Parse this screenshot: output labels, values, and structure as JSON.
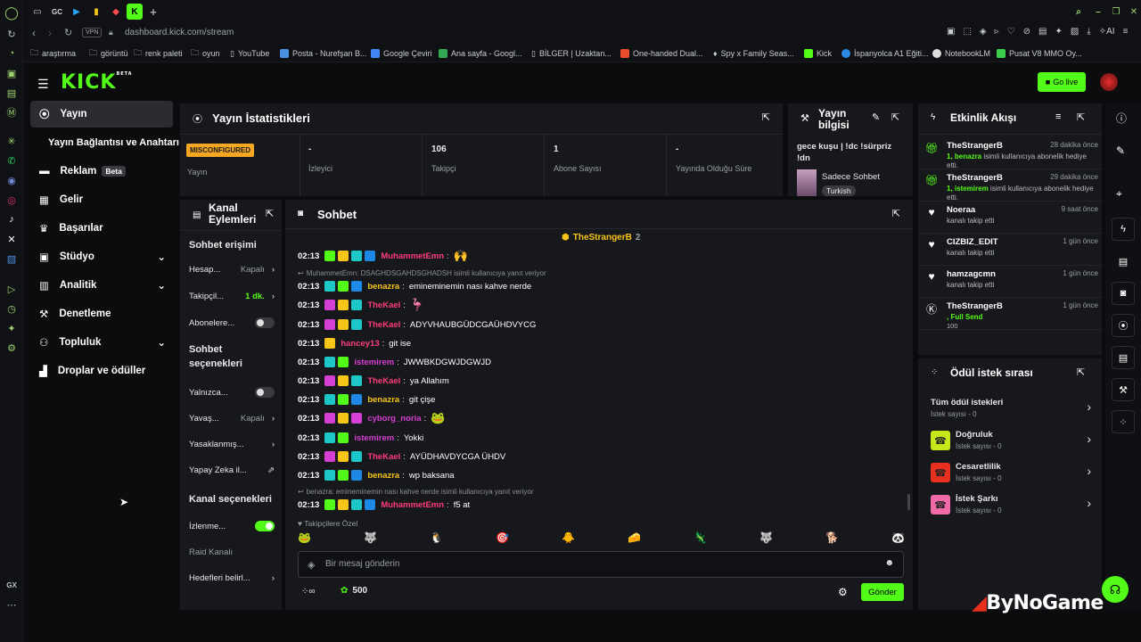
{
  "browser": {
    "tab_gc": "GC",
    "vpn": "VPN",
    "url": "dashboard.kick.com/stream",
    "ai_label": "AI",
    "bookmarks": [
      "araştırma",
      "görüntü",
      "renk paleti",
      "oyun",
      "YouTube",
      "Posta - Nurefşan B...",
      "Google Çeviri",
      "Ana sayfa - Googl...",
      "BİLGER | Uzaktan...",
      "One-handed Dual...",
      "Spy x Family Seas...",
      "Kick",
      "İspanyolca A1 Eğiti...",
      "NotebookLM",
      "Pusat V8 MMO Oy..."
    ],
    "rail_bottom": "GX"
  },
  "header": {
    "logo": "KICK",
    "logo_sup": "BETA",
    "go_live": "Go live"
  },
  "sidebar": {
    "items": [
      {
        "label": "Yayın",
        "icon": "broadcast-icon"
      },
      {
        "label": "Yayın Bağlantısı ve Anahtarı"
      },
      {
        "label": "Reklam",
        "badge": "Beta"
      },
      {
        "label": "Gelir"
      },
      {
        "label": "Başarılar"
      },
      {
        "label": "Stüdyo"
      },
      {
        "label": "Analitik"
      },
      {
        "label": "Denetleme"
      },
      {
        "label": "Topluluk"
      },
      {
        "label": "Droplar ve ödüller"
      }
    ]
  },
  "stats": {
    "title": "Yayın İstatistikleri",
    "status_badge": "MISCONFIGURED",
    "cells": [
      {
        "value": "",
        "label": "Yayın"
      },
      {
        "value": "-",
        "label": "İzleyici"
      },
      {
        "value": "106",
        "label": "Takipçi"
      },
      {
        "value": "1",
        "label": "Abone Sayısı"
      },
      {
        "value": "-",
        "label": "Yayında Olduğu Süre"
      }
    ]
  },
  "stream_info": {
    "title": "Yayın bilgisi",
    "stream_title": "gece kuşu | !dc !sürpriz !dn",
    "category": "Sadece Sohbet",
    "tag": "Turkish"
  },
  "actions": {
    "title": "Kanal Eylemleri",
    "sec1": "Sohbet erişimi",
    "rows1": [
      {
        "label": "Hesap...",
        "value": "Kapalı",
        "type": "arrow"
      },
      {
        "label": "Takipçil...",
        "value": "1 dk.",
        "type": "arrow",
        "green": true
      },
      {
        "label": "Abonelere...",
        "type": "toggle",
        "on": false
      }
    ],
    "sec2": "Sohbet seçenekleri",
    "rows2": [
      {
        "label": "Yalnızca...",
        "type": "toggle",
        "on": false
      },
      {
        "label": "Yavaş...",
        "value": "Kapalı",
        "type": "arrow"
      },
      {
        "label": "Yasaklanmış...",
        "type": "arrow"
      },
      {
        "label": "Yapay Zeka il...",
        "type": "ext"
      }
    ],
    "sec3": "Kanal seçenekleri",
    "rows3": [
      {
        "label": "İzlenme...",
        "type": "toggle",
        "on": true
      },
      {
        "label": "Raid Kanalı",
        "type": "none",
        "muted": true
      },
      {
        "label": "Hedefleri belirl...",
        "type": "arrow"
      }
    ]
  },
  "chat": {
    "title": "Sohbet",
    "pinned_user": "TheStrangerB",
    "pinned_count": "2",
    "lines": [
      {
        "time": "02:13",
        "user": "MuhammetEmn",
        "color": "#ff3c7a",
        "badges": [
          "#53fc18",
          "#f5c518",
          "#1ec8c8",
          "#1e88e5"
        ],
        "text": "",
        "emote": "🙌"
      },
      {
        "reply": "MuhammetEmn: DSAGHDSGAHDSGHADSH isimli kullanıcıya yanıt veriyor"
      },
      {
        "time": "02:13",
        "user": "benazra",
        "color": "#f5c518",
        "badges": [
          "#1ec8c8",
          "#53fc18",
          "#1e88e5"
        ],
        "text": "emineminemin nası kahve nerde"
      },
      {
        "time": "02:13",
        "user": "TheKael",
        "color": "#ff3c7a",
        "badges": [
          "#d63fd3",
          "#f5c518",
          "#1ec8c8"
        ],
        "text": "",
        "emote": "🦩"
      },
      {
        "time": "02:13",
        "user": "TheKael",
        "color": "#ff3c7a",
        "badges": [
          "#d63fd3",
          "#f5c518",
          "#1ec8c8"
        ],
        "text": "ADYVHAUBGÜDCGAÜHDVYCG"
      },
      {
        "time": "02:13",
        "user": "hancey13",
        "color": "#ff3c7a",
        "badges": [
          "#f5c518"
        ],
        "text": "git ise"
      },
      {
        "time": "02:13",
        "user": "istemirem",
        "color": "#d63fd3",
        "badges": [
          "#1ec8c8",
          "#53fc18"
        ],
        "text": "JWWBKDGWJDGWJD"
      },
      {
        "time": "02:13",
        "user": "TheKael",
        "color": "#ff3c7a",
        "badges": [
          "#d63fd3",
          "#f5c518",
          "#1ec8c8"
        ],
        "text": "ya Allahım"
      },
      {
        "time": "02:13",
        "user": "benazra",
        "color": "#f5c518",
        "badges": [
          "#1ec8c8",
          "#53fc18",
          "#1e88e5"
        ],
        "text": "git çişe"
      },
      {
        "time": "02:13",
        "user": "cyborg_noria",
        "color": "#d63fd3",
        "badges": [
          "#d63fd3",
          "#f5c518",
          "#d63fd3"
        ],
        "text": "",
        "emote": "🐸"
      },
      {
        "time": "02:13",
        "user": "istemirem",
        "color": "#d63fd3",
        "badges": [
          "#1ec8c8",
          "#53fc18"
        ],
        "text": "Yokki"
      },
      {
        "time": "02:13",
        "user": "TheKael",
        "color": "#ff3c7a",
        "badges": [
          "#d63fd3",
          "#f5c518",
          "#1ec8c8"
        ],
        "text": "AYÜDHAVDYCGA ÜHDV"
      },
      {
        "time": "02:13",
        "user": "benazra",
        "color": "#f5c518",
        "badges": [
          "#1ec8c8",
          "#53fc18",
          "#1e88e5"
        ],
        "text": "wp baksana"
      },
      {
        "reply": "benazra: emineminemin nası kahve nerde isimli kullanıcıya yanıt veriyor"
      },
      {
        "time": "02:13",
        "user": "MuhammetEmn",
        "color": "#ff3c7a",
        "badges": [
          "#53fc18",
          "#f5c518",
          "#1ec8c8",
          "#1e88e5"
        ],
        "text": "f5 at"
      }
    ],
    "followers_label": "Takipçilere Özel",
    "emotes": [
      "🐸",
      "🐺",
      "🐧",
      "🎯",
      "🐥",
      "🧀",
      "🦎",
      "🐺",
      "🐕",
      "🐼"
    ],
    "input_placeholder": "Bir mesaj gönderin",
    "points": "500",
    "send": "Gönder"
  },
  "activity": {
    "title": "Etkinlik Akışı",
    "events": [
      {
        "name": "TheStrangerB",
        "time": "28 dakika önce",
        "hl": "1, benazra",
        "sub": " isimli kullanıcıya abonelik hediye etti.",
        "icon": "gift-icon"
      },
      {
        "name": "TheStrangerB",
        "time": "29 dakika önce",
        "hl": "1, istemirem",
        "sub": " isimli kullanıcıya abonelik hediye etti.",
        "icon": "gift-icon"
      },
      {
        "name": "Noeraa",
        "time": "9 saat önce",
        "hl": "",
        "sub": "kanalı takip etti",
        "icon": "heart-icon"
      },
      {
        "name": "CIZBIZ_EDIT",
        "time": "1 gün önce",
        "hl": "",
        "sub": "kanalı takip etti",
        "icon": "heart-icon"
      },
      {
        "name": "hamzagcmn",
        "time": "1 gün önce",
        "hl": "",
        "sub": "kanalı takip etti",
        "icon": "heart-icon"
      },
      {
        "name": "TheStrangerB",
        "time": "1 gün önce",
        "hl": ", Full Send",
        "sub": "",
        "icon": "kick-icon",
        "extra": "100"
      }
    ]
  },
  "rewards": {
    "title": "Ödül istek sırası",
    "all": "Tüm ödül istekleri",
    "all_sub": "İstek sayısı - 0",
    "items": [
      {
        "label": "Doğruluk",
        "sub": "İstek sayısı - 0",
        "color": "#c6e81a"
      },
      {
        "label": "Cesaretlilik",
        "sub": "İstek sayısı - 0",
        "color": "#e8301f"
      },
      {
        "label": "İstek Şarkı",
        "sub": "İstek sayısı - 0",
        "color": "#f06aa8"
      }
    ]
  },
  "watermark": "ByNoGame"
}
